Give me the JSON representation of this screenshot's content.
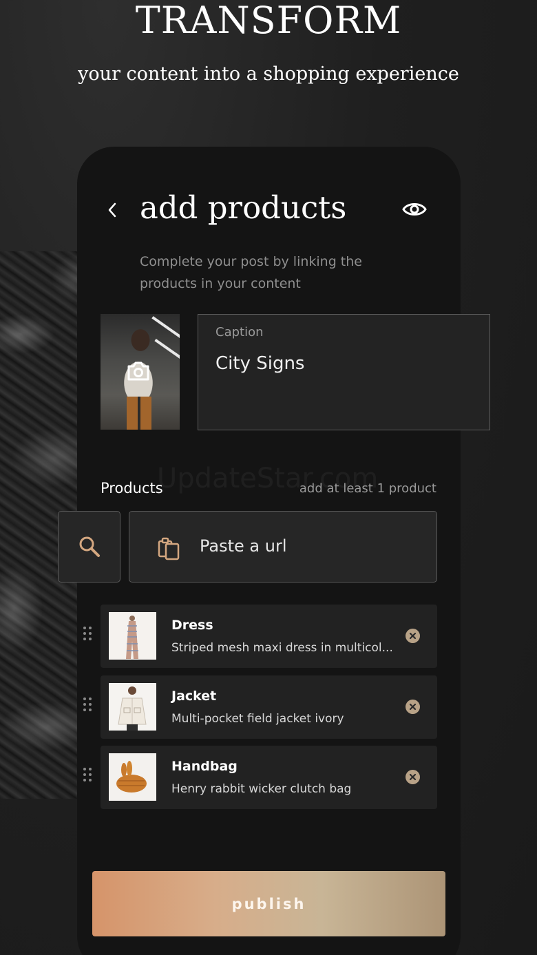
{
  "hero": {
    "title": "TRANSFORM",
    "subtitle": "your content into a shopping experience"
  },
  "screen": {
    "title": "add products",
    "intro": "Complete your post by linking the products in your content"
  },
  "caption": {
    "label": "Caption",
    "value": "City Signs"
  },
  "products": {
    "label": "Products",
    "hint": "add at least 1 product",
    "url_placeholder": "Paste a url",
    "items": [
      {
        "title": "Dress",
        "description": "Striped mesh maxi dress in multicol..."
      },
      {
        "title": "Jacket",
        "description": "Multi-pocket field jacket ivory"
      },
      {
        "title": "Handbag",
        "description": "Henry rabbit wicker clutch bag"
      }
    ]
  },
  "watermark": "UpdateStar.com",
  "publish_label": "publish",
  "colors": {
    "background": "#1f1f1f",
    "phone": "#141414",
    "field": "#262626",
    "accent_start": "#d6946a",
    "accent_end": "#ac9476",
    "remove_badge": "#b8a287"
  },
  "icons": [
    "back-icon",
    "eye-icon",
    "camera-icon",
    "search-icon",
    "clipboard-icon",
    "drag-handle-icon",
    "remove-icon"
  ]
}
